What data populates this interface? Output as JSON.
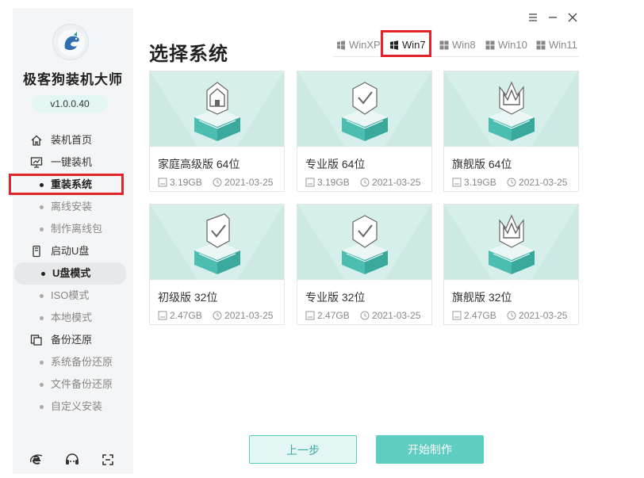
{
  "app": {
    "name": "极客狗装机大师",
    "version": "v1.0.0.40"
  },
  "nav": {
    "home": "装机首页",
    "one_click": "一键装机",
    "reinstall": "重装系统",
    "offline_install": "离线安装",
    "make_offline_pkg": "制作离线包",
    "boot_usb": "启动U盘",
    "usb_mode": "U盘模式",
    "iso_mode": "ISO模式",
    "local_mode": "本地模式",
    "backup_restore": "备份还原",
    "system_backup": "系统备份还原",
    "file_backup": "文件备份还原",
    "custom_install": "自定义安装"
  },
  "page": {
    "title": "选择系统"
  },
  "tabs": [
    {
      "label": "WinXP",
      "icon": "windows-icon"
    },
    {
      "label": "Win7",
      "icon": "windows-icon",
      "active": true
    },
    {
      "label": "Win8",
      "icon": "windows-icon"
    },
    {
      "label": "Win10",
      "icon": "windows-icon"
    },
    {
      "label": "Win11",
      "icon": "windows-icon"
    }
  ],
  "cards": [
    {
      "name": "家庭高级版 64位",
      "size": "3.19GB",
      "date": "2021-03-25",
      "icon": "home-icon"
    },
    {
      "name": "专业版 64位",
      "size": "3.19GB",
      "date": "2021-03-25",
      "icon": "check-shield-icon"
    },
    {
      "name": "旗舰版 64位",
      "size": "3.19GB",
      "date": "2021-03-25",
      "icon": "crown-icon"
    },
    {
      "name": "初级版 32位",
      "size": "2.47GB",
      "date": "2021-03-25",
      "icon": "check-tag-icon"
    },
    {
      "name": "专业版 32位",
      "size": "2.47GB",
      "date": "2021-03-25",
      "icon": "check-shield-icon"
    },
    {
      "name": "旗舰版 32位",
      "size": "2.47GB",
      "date": "2021-03-25",
      "icon": "crown-icon"
    }
  ],
  "buttons": {
    "prev": "上一步",
    "start": "开始制作"
  },
  "colors": {
    "accent": "#5fcdc2",
    "highlight": "#e5232a",
    "card_art_bg": "#d7efeb"
  }
}
